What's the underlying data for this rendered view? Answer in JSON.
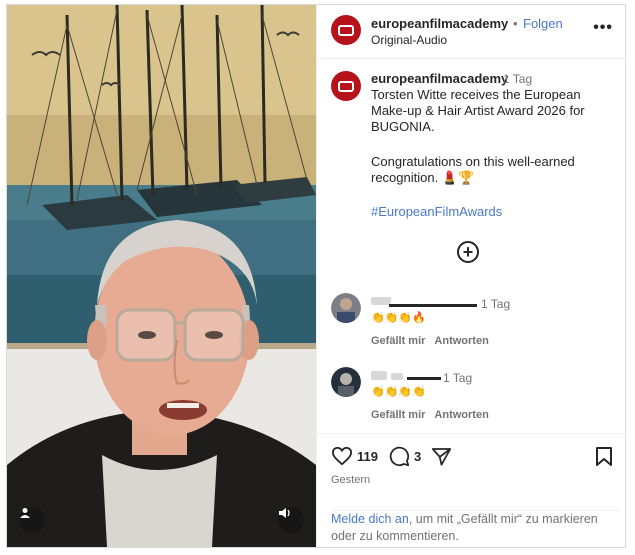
{
  "post": {
    "account": "europeanfilmacademy",
    "follow_dot": "•",
    "follow_label": "Folgen",
    "audio_label": "Original-Audio",
    "more_label": "•••"
  },
  "caption": {
    "account": "europeanfilmacademy",
    "time": "1 Tag",
    "text": "Torsten Witte receives the European Make-up & Hair Artist Award 2026 for BUGONIA.",
    "text2": "Congratulations on this well-earned recognition. 💄🏆",
    "hashtag": "#EuropeanFilmAwards"
  },
  "comments": [
    {
      "time": "1 Tag",
      "emoji": "👏👏👏🔥",
      "like_label": "Gefällt mir",
      "reply_label": "Antworten"
    },
    {
      "time": "1 Tag",
      "emoji": "👏👏👏👏",
      "like_label": "Gefällt mir",
      "reply_label": "Antworten"
    }
  ],
  "actions": {
    "likes": "119",
    "comments": "3",
    "date": "Gestern"
  },
  "login": {
    "link": "Melde dich an",
    "rest": ", um mit „Gefällt mir“ zu markieren oder zu kommentieren."
  },
  "colors": {
    "brand": "#b5121b",
    "link": "#4a79c7",
    "muted": "#737373"
  },
  "icons": [
    "user-icon",
    "sound-icon",
    "heart-icon",
    "comment-icon",
    "share-icon",
    "bookmark-icon",
    "add-circle-icon",
    "more-icon"
  ]
}
